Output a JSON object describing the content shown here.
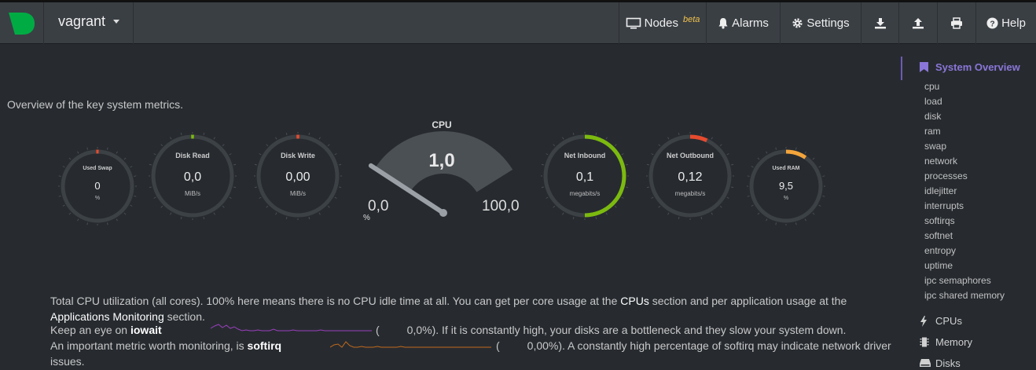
{
  "colors": {
    "background": "#272b30",
    "topbar": "#3a3f44",
    "logo": "#00ab44",
    "gauge_track": "#3c4146",
    "accent_green": "#7cba0f",
    "accent_red": "#e64b2e",
    "accent_orange": "#f3a43b",
    "cpu_needle": "#4cc9c9",
    "sidebar_active": "#8a76d8",
    "iowait_spark": "#9a3fbd",
    "softirq_spark": "#c2691a"
  },
  "header": {
    "hostname": "vagrant",
    "nav": [
      {
        "label": "Nodes",
        "badge": "beta",
        "icon": "monitor-icon"
      },
      {
        "label": "Alarms",
        "icon": "bell-icon"
      },
      {
        "label": "Settings",
        "icon": "gear-icon"
      },
      {
        "label": "",
        "icon": "download-icon"
      },
      {
        "label": "",
        "icon": "upload-icon"
      },
      {
        "label": "",
        "icon": "print-icon"
      },
      {
        "label": "Help",
        "icon": "question-icon"
      }
    ]
  },
  "main": {
    "intro": "Overview of the key system metrics.",
    "gauges": {
      "used_swap": {
        "label": "Used Swap",
        "value": "0",
        "unit": "%",
        "level": 0.0
      },
      "disk_read": {
        "label": "Disk Read",
        "value": "0,0",
        "unit": "MiB/s",
        "level": 0.0
      },
      "disk_write": {
        "label": "Disk Write",
        "value": "0,00",
        "unit": "MiB/s",
        "level": 0.0
      },
      "cpu": {
        "label": "CPU",
        "value": "1,0",
        "min": "0,0",
        "max": "100,0",
        "unit": "%",
        "level": 0.01
      },
      "net_inbound": {
        "label": "Net Inbound",
        "value": "0,1",
        "unit": "megabits/s",
        "level": 0.5
      },
      "net_outbound": {
        "label": "Net Outbound",
        "value": "0,12",
        "unit": "megabits/s",
        "level": 0.07
      },
      "used_ram": {
        "label": "Used RAM",
        "value": "9,5",
        "unit": "%",
        "level": 0.095
      }
    },
    "description": {
      "p1_a": "Total CPU utilization (all cores). 100% here means there is no CPU idle time at all. You can get per core usage at the ",
      "p1_link1": "CPUs",
      "p1_b": " section and per application usage at the ",
      "p1_link2": "Applications Monitoring",
      "p1_c": " section."
    },
    "iowait": {
      "prefix": "Keep an eye on ",
      "keyword": "iowait",
      "value": "0,0%",
      "suffix": "). If it is constantly high, your disks are a bottleneck and they slow your system down."
    },
    "softirq": {
      "prefix": "An important metric worth monitoring, is ",
      "keyword": "softirq",
      "value": "0,00%",
      "suffix": "). A constantly high percentage of softirq may indicate network driver",
      "suffix2": "issues."
    }
  },
  "sidebar": {
    "title": "System Overview",
    "items": [
      "cpu",
      "load",
      "disk",
      "ram",
      "swap",
      "network",
      "processes",
      "idlejitter",
      "interrupts",
      "softirqs",
      "softnet",
      "entropy",
      "uptime",
      "ipc semaphores",
      "ipc shared memory"
    ],
    "sections": [
      {
        "label": "CPUs",
        "icon": "bolt-icon"
      },
      {
        "label": "Memory",
        "icon": "memory-chip-icon"
      },
      {
        "label": "Disks",
        "icon": "hdd-icon"
      }
    ]
  }
}
